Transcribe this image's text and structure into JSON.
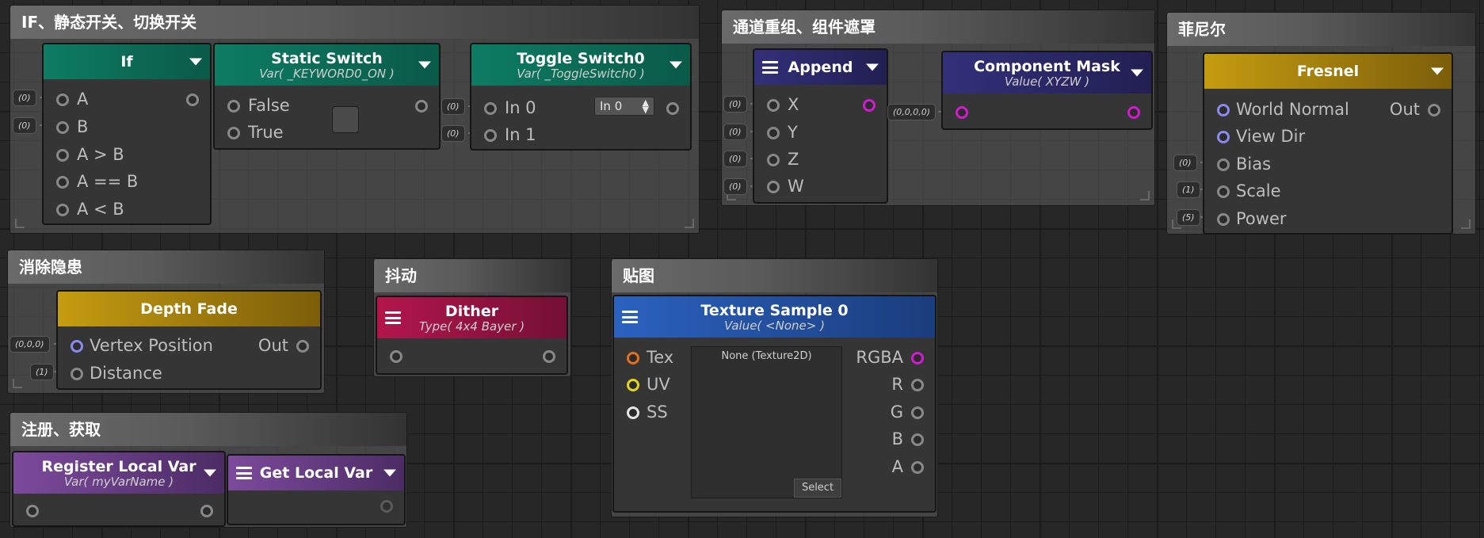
{
  "groups": {
    "if": {
      "title": "IF、静态开关、切换开关"
    },
    "channel": {
      "title": "通道重组、组件遮罩"
    },
    "fresnel": {
      "title": "菲尼尔"
    },
    "depth": {
      "title": "消除隐患"
    },
    "dither": {
      "title": "抖动"
    },
    "texture": {
      "title": "贴图"
    },
    "register": {
      "title": "注册、获取"
    }
  },
  "nodes": {
    "if": {
      "title": "If",
      "inputs": [
        "A",
        "B",
        "A > B",
        "A == B",
        "A < B"
      ],
      "defaults": [
        "(0)",
        "(0)"
      ]
    },
    "static_switch": {
      "title": "Static Switch",
      "subtitle": "Var( _KEYWORD0_ON )",
      "inputs": [
        "False",
        "True"
      ]
    },
    "toggle_switch": {
      "title": "Toggle Switch0",
      "subtitle": "Var( _ToggleSwitch0 )",
      "inputs": [
        "In 0",
        "In 1"
      ],
      "dropdown": "In 0",
      "defaults": [
        "(0)",
        "(0)"
      ]
    },
    "append": {
      "title": "Append",
      "inputs": [
        "X",
        "Y",
        "Z",
        "W"
      ],
      "defaults": [
        "(0)",
        "(0)",
        "(0)",
        "(0)"
      ]
    },
    "component_mask": {
      "title": "Component Mask",
      "subtitle": "Value( XYZW )",
      "defaults": [
        "(0,0,0,0)"
      ]
    },
    "fresnel": {
      "title": "Fresnel",
      "inputs": [
        "World Normal",
        "View Dir",
        "Bias",
        "Scale",
        "Power"
      ],
      "output": "Out",
      "defaults": [
        "(0)",
        "(1)",
        "(5)"
      ]
    },
    "depth_fade": {
      "title": "Depth Fade",
      "inputs": [
        "Vertex Position",
        "Distance"
      ],
      "output": "Out",
      "defaults": [
        "(0,0,0)",
        "(1)"
      ]
    },
    "dither": {
      "title": "Dither",
      "subtitle": "Type( 4x4 Bayer )"
    },
    "texture_sample": {
      "title": "Texture Sample 0",
      "subtitle": "Value( <None> )",
      "inputs": [
        "Tex",
        "UV",
        "SS"
      ],
      "outputs": [
        "RGBA",
        "R",
        "G",
        "B",
        "A"
      ],
      "preview": "None (Texture2D)",
      "select_label": "Select"
    },
    "register_local_var": {
      "title": "Register Local Var",
      "subtitle": "Var( myVarName )"
    },
    "get_local_var": {
      "title": "Get Local Var"
    }
  }
}
